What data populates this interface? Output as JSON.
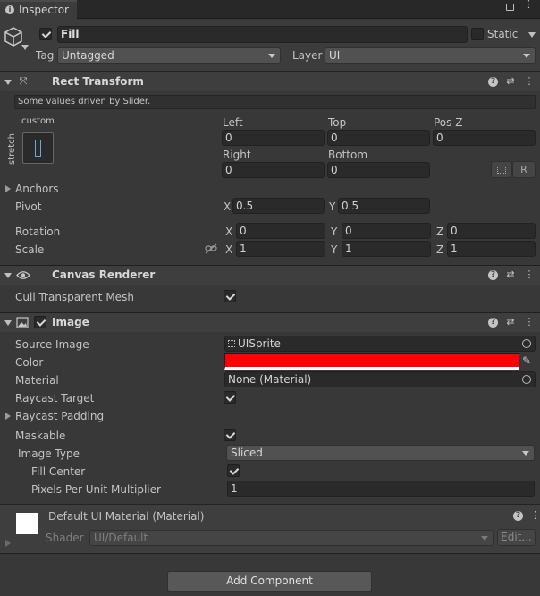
{
  "tab": {
    "title": "Inspector"
  },
  "object": {
    "name": "Fill",
    "static_label": "Static",
    "tag_label": "Tag",
    "tag_value": "Untagged",
    "layer_label": "Layer",
    "layer_value": "UI"
  },
  "rect_transform": {
    "title": "Rect Transform",
    "note": "Some values driven by Slider.",
    "anchor_preset_top": "custom",
    "anchor_preset_side": "stretch",
    "left_label": "Left",
    "left_value": "0",
    "top_label": "Top",
    "top_value": "0",
    "posz_label": "Pos Z",
    "posz_value": "0",
    "right_label": "Right",
    "right_value": "0",
    "bottom_label": "Bottom",
    "bottom_value": "0",
    "r_button": "R",
    "anchors_label": "Anchors",
    "pivot_label": "Pivot",
    "pivot_x": "0.5",
    "pivot_y": "0.5",
    "rotation_label": "Rotation",
    "rot_x": "0",
    "rot_y": "0",
    "rot_z": "0",
    "scale_label": "Scale",
    "scale_x": "1",
    "scale_y": "1",
    "scale_z": "1",
    "x": "X",
    "y": "Y",
    "z": "Z"
  },
  "canvas_renderer": {
    "title": "Canvas Renderer",
    "cull_label": "Cull Transparent Mesh",
    "cull_checked": true
  },
  "image": {
    "title": "Image",
    "source_image_label": "Source Image",
    "source_image_value": "UISprite",
    "color_label": "Color",
    "color_value": "#ff0000",
    "material_label": "Material",
    "material_value": "None (Material)",
    "raycast_target_label": "Raycast Target",
    "raycast_padding_label": "Raycast Padding",
    "maskable_label": "Maskable",
    "image_type_label": "Image Type",
    "image_type_value": "Sliced",
    "fill_center_label": "Fill Center",
    "ppu_label": "Pixels Per Unit Multiplier",
    "ppu_value": "1"
  },
  "material": {
    "title": "Default UI Material (Material)",
    "shader_label": "Shader",
    "shader_value": "UI/Default",
    "edit_button": "Edit..."
  },
  "add_component": "Add Component"
}
